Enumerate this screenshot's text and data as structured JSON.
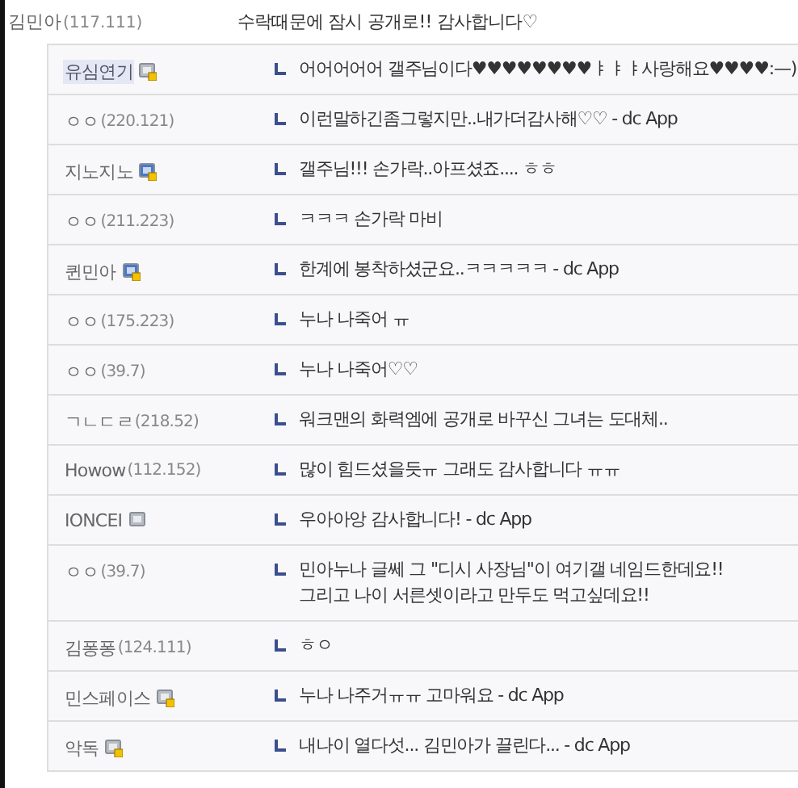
{
  "comment": {
    "nick": "김민아",
    "ip": "(117.111)",
    "text": "수락때문에 잠시 공개로!! 감사합니다♡"
  },
  "replies": [
    {
      "nick": "유심연기",
      "kind": "fixed-gray",
      "highlighted": true,
      "text": "어어어어어 갤주님이다♥♥♥♥♥♥♥♥ㅑㅑㅑ사랑해요♥♥♥♥:—)"
    },
    {
      "nick": "ㅇㅇ",
      "ip": "(220.121)",
      "kind": "plain",
      "highlighted": false,
      "text": "이런말하긴좀그렇지만..내가더감사해♡♡ - dc App"
    },
    {
      "nick": "지노지노",
      "kind": "fixed-blue",
      "highlighted": false,
      "text": "갤주님!!! 손가락..아프셨죠.... ㅎㅎ"
    },
    {
      "nick": "ㅇㅇ",
      "ip": "(211.223)",
      "kind": "plain",
      "highlighted": false,
      "text": "ㅋㅋㅋ 손가락 마비"
    },
    {
      "nick": "퀸민아",
      "kind": "fixed-blue",
      "highlighted": false,
      "text": "한계에 봉착하셨군요..ㅋㅋㅋㅋㅋ - dc App"
    },
    {
      "nick": "ㅇㅇ",
      "ip": "(175.223)",
      "kind": "plain",
      "highlighted": false,
      "text": "누나 나죽어 ㅠ"
    },
    {
      "nick": "ㅇㅇ",
      "ip": "(39.7)",
      "kind": "plain",
      "highlighted": false,
      "text": "누나 나죽어♡♡"
    },
    {
      "nick": "ㄱㄴㄷㄹ",
      "ip": "(218.52)",
      "kind": "plain",
      "highlighted": false,
      "text": "워크맨의 화력엠에 공개로 바꾸신 그녀는 도대체.."
    },
    {
      "nick": "Howow",
      "ip": "(112.152)",
      "kind": "plain",
      "highlighted": false,
      "text": "많이 힘드셨을듯ㅠ 그래도 감사합니다 ㅠㅠ"
    },
    {
      "nick": "IONCEI",
      "kind": "gray",
      "highlighted": false,
      "text": "우아아앙 감사합니다! - dc App"
    },
    {
      "nick": "ㅇㅇ",
      "ip": "(39.7)",
      "kind": "plain",
      "highlighted": false,
      "text": "민아누나 글쎄 그 \"디시 사장님\"이 여기갤 네임드한데요!!\n그리고 나이 서른셋이라고 만두도 먹고싶데요!!"
    },
    {
      "nick": "김퐁퐁",
      "ip": "(124.111)",
      "kind": "plain",
      "highlighted": false,
      "text": "ㅎㅇ"
    },
    {
      "nick": "민스페이스",
      "kind": "fixed-gray",
      "highlighted": false,
      "text": "누나 나주거ㅠㅠ 고마워요 - dc App"
    },
    {
      "nick": "악독",
      "kind": "fixed-gray",
      "highlighted": false,
      "text": "내나이 열다섯... 김민아가 끌린다... - dc App"
    }
  ]
}
